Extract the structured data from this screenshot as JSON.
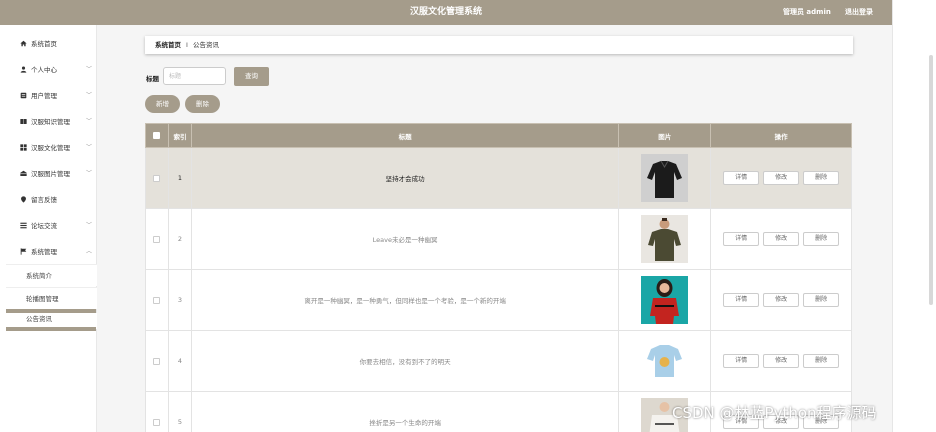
{
  "header": {
    "title": "汉服文化管理系统",
    "admin_label": "管理员 admin",
    "logout_label": "退出登录",
    "bg_color": "#a59c8b"
  },
  "sidebar": {
    "items": [
      {
        "label": "系统首页",
        "icon": "home-icon"
      },
      {
        "label": "个人中心",
        "icon": "user-icon"
      },
      {
        "label": "用户管理",
        "icon": "user-manage-icon"
      },
      {
        "label": "汉服知识管理",
        "icon": "book-icon"
      },
      {
        "label": "汉服文化管理",
        "icon": "grid-icon"
      },
      {
        "label": "汉服图片管理",
        "icon": "image-icon"
      },
      {
        "label": "留言反馈",
        "icon": "location-icon"
      },
      {
        "label": "论坛交流",
        "icon": "list-icon"
      },
      {
        "label": "系统管理",
        "icon": "flag-icon"
      }
    ],
    "sub_items": [
      {
        "label": "系统简介"
      },
      {
        "label": "轮播图管理"
      },
      {
        "label": "公告资讯"
      }
    ]
  },
  "breadcrumb": {
    "home": "系统首页",
    "separator": "I",
    "current": "公告资讯"
  },
  "search": {
    "label": "标题",
    "placeholder": "标题",
    "value": "",
    "button_label": "查询"
  },
  "actions": {
    "add_label": "新增",
    "delete_label": "删除"
  },
  "table": {
    "headers": [
      "索引",
      "标题",
      "图片",
      "操作"
    ],
    "op_labels": [
      "详情",
      "修改",
      "删除"
    ],
    "rows": [
      {
        "index": "1",
        "title": "坚持才会成功",
        "selected": true,
        "image": "black-shirt"
      },
      {
        "index": "2",
        "title": "Leave未必是一种幽冥",
        "selected": false,
        "image": "olive-shirt"
      },
      {
        "index": "3",
        "title": "离开是一种幽冥，是一种勇气，但同样也是一个考验，是一个新的开端",
        "selected": false,
        "image": "red-dress"
      },
      {
        "index": "4",
        "title": "你要去相信，没有到不了的明天",
        "selected": false,
        "image": "kids-tee"
      },
      {
        "index": "5",
        "title": "挫折是另一个生命的开端",
        "selected": false,
        "image": "white-sweater"
      }
    ]
  },
  "watermark": "CSDN @林蓝Python程序源码"
}
